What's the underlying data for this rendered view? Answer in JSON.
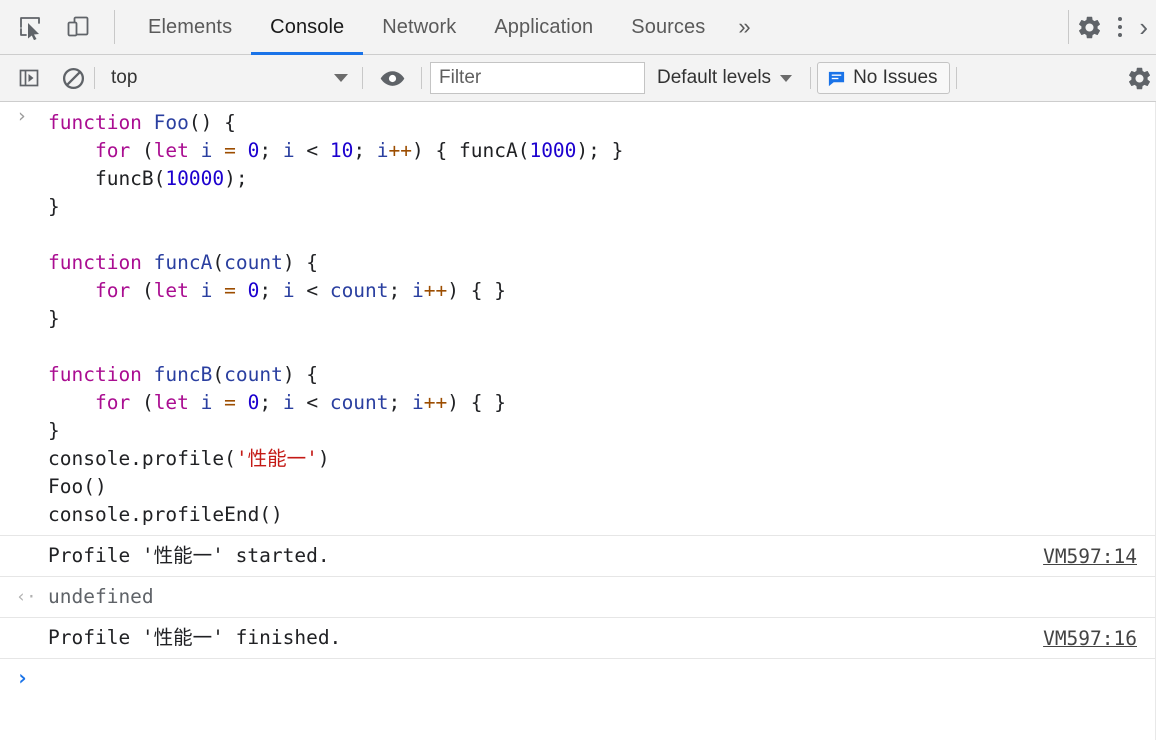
{
  "toolbar": {
    "inspect_icon": "inspect-element-icon",
    "device_icon": "device-toolbar-icon",
    "settings_icon": "gear-icon",
    "more_icon": "more-vertical-icon",
    "overflow_icon": "chevron-right-icon",
    "tabs": [
      {
        "label": "Elements",
        "active": false
      },
      {
        "label": "Console",
        "active": true
      },
      {
        "label": "Network",
        "active": false
      },
      {
        "label": "Application",
        "active": false
      },
      {
        "label": "Sources",
        "active": false
      }
    ],
    "more_tabs_label": "»"
  },
  "console_toolbar": {
    "sidebar_toggle_icon": "console-sidebar-toggle-icon",
    "clear_icon": "clear-console-icon",
    "context_value": "top",
    "eye_icon": "live-expression-eye-icon",
    "filter_placeholder": "Filter",
    "filter_value": "",
    "levels_label": "Default levels",
    "issues_icon": "issues-message-icon",
    "issues_label": "No Issues",
    "settings_icon": "gear-icon"
  },
  "console": {
    "input_marker": "›",
    "output_marker": "‹·",
    "prompt_marker": "›",
    "prompt_value": "",
    "code_lines": [
      [
        {
          "t": "function ",
          "c": "kw"
        },
        {
          "t": "Foo",
          "c": "ident"
        },
        {
          "t": "() {",
          "c": "plain"
        }
      ],
      [
        {
          "t": "    ",
          "c": "plain"
        },
        {
          "t": "for ",
          "c": "kw"
        },
        {
          "t": "(",
          "c": "plain"
        },
        {
          "t": "let ",
          "c": "kw"
        },
        {
          "t": "i ",
          "c": "ident"
        },
        {
          "t": "= ",
          "c": "op"
        },
        {
          "t": "0",
          "c": "num"
        },
        {
          "t": "; ",
          "c": "plain"
        },
        {
          "t": "i ",
          "c": "ident"
        },
        {
          "t": "< ",
          "c": "plain"
        },
        {
          "t": "10",
          "c": "num"
        },
        {
          "t": "; ",
          "c": "plain"
        },
        {
          "t": "i",
          "c": "ident"
        },
        {
          "t": "++",
          "c": "op"
        },
        {
          "t": ") { ",
          "c": "plain"
        },
        {
          "t": "funcA",
          "c": "plain"
        },
        {
          "t": "(",
          "c": "plain"
        },
        {
          "t": "1000",
          "c": "num"
        },
        {
          "t": "); }",
          "c": "plain"
        }
      ],
      [
        {
          "t": "    funcB(",
          "c": "plain"
        },
        {
          "t": "10000",
          "c": "num"
        },
        {
          "t": ");",
          "c": "plain"
        }
      ],
      [
        {
          "t": "}",
          "c": "plain"
        }
      ],
      [
        {
          "t": "",
          "c": "plain"
        }
      ],
      [
        {
          "t": "function ",
          "c": "kw"
        },
        {
          "t": "funcA",
          "c": "ident"
        },
        {
          "t": "(",
          "c": "plain"
        },
        {
          "t": "count",
          "c": "ident"
        },
        {
          "t": ") {",
          "c": "plain"
        }
      ],
      [
        {
          "t": "    ",
          "c": "plain"
        },
        {
          "t": "for ",
          "c": "kw"
        },
        {
          "t": "(",
          "c": "plain"
        },
        {
          "t": "let ",
          "c": "kw"
        },
        {
          "t": "i ",
          "c": "ident"
        },
        {
          "t": "= ",
          "c": "op"
        },
        {
          "t": "0",
          "c": "num"
        },
        {
          "t": "; ",
          "c": "plain"
        },
        {
          "t": "i ",
          "c": "ident"
        },
        {
          "t": "< ",
          "c": "plain"
        },
        {
          "t": "count",
          "c": "ident"
        },
        {
          "t": "; ",
          "c": "plain"
        },
        {
          "t": "i",
          "c": "ident"
        },
        {
          "t": "++",
          "c": "op"
        },
        {
          "t": ") { }",
          "c": "plain"
        }
      ],
      [
        {
          "t": "}",
          "c": "plain"
        }
      ],
      [
        {
          "t": "",
          "c": "plain"
        }
      ],
      [
        {
          "t": "function ",
          "c": "kw"
        },
        {
          "t": "funcB",
          "c": "ident"
        },
        {
          "t": "(",
          "c": "plain"
        },
        {
          "t": "count",
          "c": "ident"
        },
        {
          "t": ") {",
          "c": "plain"
        }
      ],
      [
        {
          "t": "    ",
          "c": "plain"
        },
        {
          "t": "for ",
          "c": "kw"
        },
        {
          "t": "(",
          "c": "plain"
        },
        {
          "t": "let ",
          "c": "kw"
        },
        {
          "t": "i ",
          "c": "ident"
        },
        {
          "t": "= ",
          "c": "op"
        },
        {
          "t": "0",
          "c": "num"
        },
        {
          "t": "; ",
          "c": "plain"
        },
        {
          "t": "i ",
          "c": "ident"
        },
        {
          "t": "< ",
          "c": "plain"
        },
        {
          "t": "count",
          "c": "ident"
        },
        {
          "t": "; ",
          "c": "plain"
        },
        {
          "t": "i",
          "c": "ident"
        },
        {
          "t": "++",
          "c": "op"
        },
        {
          "t": ") { }",
          "c": "plain"
        }
      ],
      [
        {
          "t": "}",
          "c": "plain"
        }
      ],
      [
        {
          "t": "console.profile(",
          "c": "plain"
        },
        {
          "t": "'性能一'",
          "c": "str"
        },
        {
          "t": ")",
          "c": "plain"
        }
      ],
      [
        {
          "t": "Foo()",
          "c": "plain"
        }
      ],
      [
        {
          "t": "console.profileEnd()",
          "c": "plain"
        }
      ]
    ],
    "results": [
      {
        "marker": "",
        "text": "Profile '性能一' started.",
        "source": "VM597:14",
        "kind": "log"
      },
      {
        "marker": "‹·",
        "text": "undefined",
        "source": "",
        "kind": "undefined"
      },
      {
        "marker": "",
        "text": "Profile '性能一' finished.",
        "source": "VM597:16",
        "kind": "log"
      }
    ]
  },
  "colors": {
    "accent": "#1a73e8",
    "toolbar_bg": "#f3f3f3",
    "keyword": "#aa0d91",
    "identifier": "#2a3fa0",
    "operator": "#9c4d00",
    "number": "#1c00cf",
    "string": "#c41a16"
  }
}
